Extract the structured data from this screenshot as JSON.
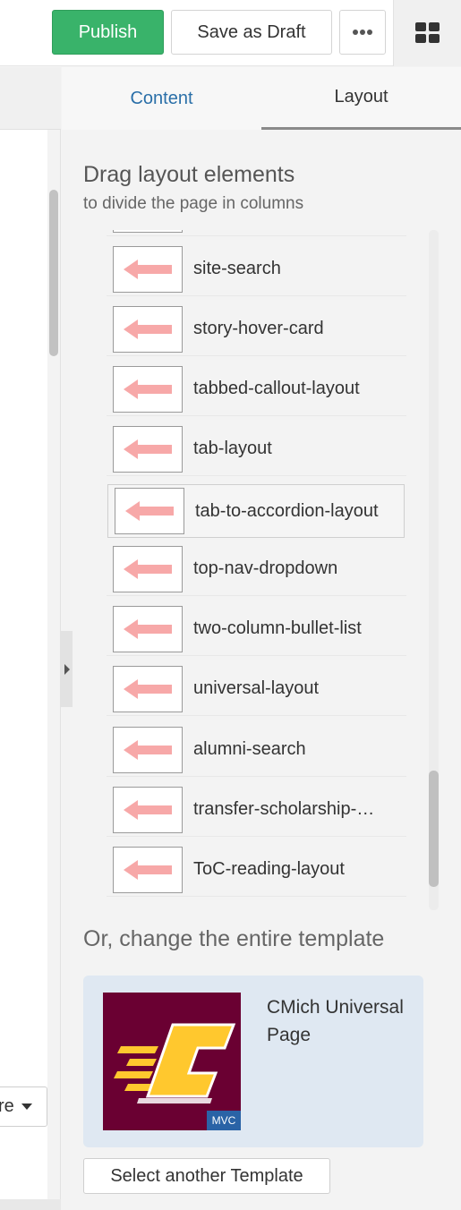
{
  "toolbar": {
    "publish_label": "Publish",
    "draft_label": "Save as Draft",
    "more_icon": "ellipsis-icon",
    "grid_icon": "grid-icon"
  },
  "tabs": [
    {
      "label": "Content",
      "active": false
    },
    {
      "label": "Layout",
      "active": true
    }
  ],
  "panel": {
    "heading": "Drag layout elements",
    "subheading": "to divide the page in columns",
    "items": [
      {
        "label": "site-search"
      },
      {
        "label": "story-hover-card"
      },
      {
        "label": "tabbed-callout-layout"
      },
      {
        "label": "tab-layout"
      },
      {
        "label": "tab-to-accordion-layout"
      },
      {
        "label": "top-nav-dropdown"
      },
      {
        "label": "two-column-bullet-list"
      },
      {
        "label": "universal-layout"
      },
      {
        "label": "alumni-search"
      },
      {
        "label": "transfer-scholarship-…"
      },
      {
        "label": "ToC-reading-layout"
      }
    ],
    "template_heading": "Or, change the entire template",
    "template": {
      "name": "CMich Universal Page",
      "badge": "MVC"
    },
    "select_template_label": "Select another Template"
  },
  "left": {
    "dropdown_text": "re"
  },
  "colors": {
    "publish": "#39b36a",
    "active_tab_text": "#2a6fa8",
    "arrow": "#f7a8a8",
    "cmich_maroon": "#6a0032",
    "cmich_gold": "#ffc82e",
    "card_bg": "#dfe8f2"
  }
}
